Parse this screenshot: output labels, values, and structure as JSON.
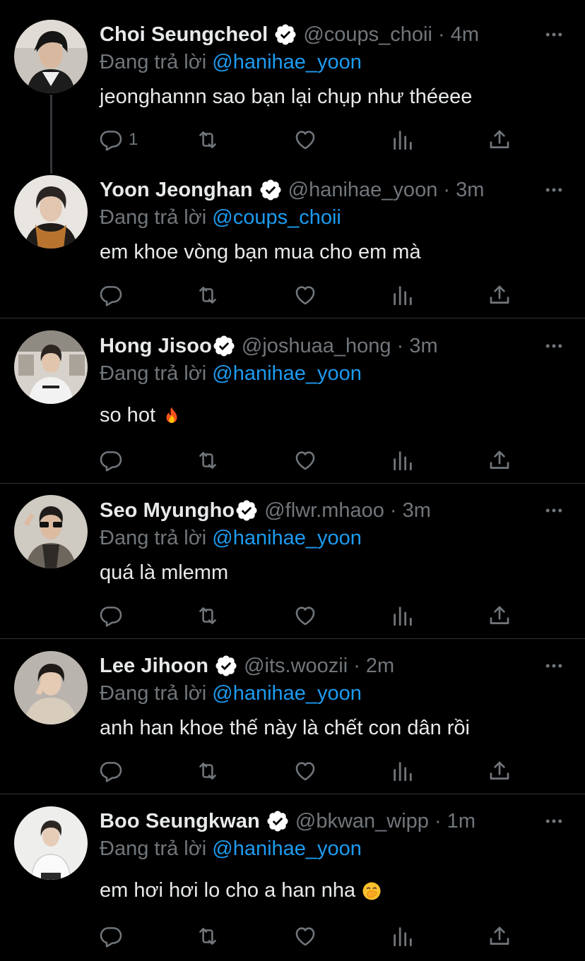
{
  "colors": {
    "background": "#000000",
    "text": "#e7e9ea",
    "muted": "#71767b",
    "link": "#1d9bf0",
    "verified": "#ffffff"
  },
  "tweets": [
    {
      "name": "Choi Seungcheol",
      "handle": "@coups_choii · 4m",
      "reply_prefix": "Đang trả lời ",
      "reply_mention": "@hanihae_yoon",
      "text": "jeonghannn sao bạn lại chụp như théeee",
      "emoji": "",
      "reply_count": "1",
      "avatar_icon": "avatar-dark-hair-icon"
    },
    {
      "name": "Yoon Jeonghan",
      "handle": "@hanihae_yoon · 3m",
      "reply_prefix": "Đang trả lời ",
      "reply_mention": "@coups_choii",
      "text": "em khoe vòng bạn mua cho em mà",
      "emoji": "",
      "reply_count": "",
      "avatar_icon": "avatar-brown-scarf-icon"
    },
    {
      "name": "Hong Jisoo",
      "handle": "@joshuaa_hong · 3m",
      "reply_prefix": "Đang trả lời ",
      "reply_mention": "@hanihae_yoon",
      "text": "so hot",
      "emoji": "fire-emoji",
      "reply_count": "",
      "avatar_icon": "avatar-white-tee-icon"
    },
    {
      "name": "Seo Myungho",
      "handle": "@flwr.mhaoo · 3m",
      "reply_prefix": "Đang trả lời ",
      "reply_mention": "@hanihae_yoon",
      "text": "quá là mlemm",
      "emoji": "",
      "reply_count": "",
      "avatar_icon": "avatar-sunglasses-icon"
    },
    {
      "name": "Lee Jihoon",
      "handle": "@its.woozii · 2m",
      "reply_prefix": "Đang trả lời ",
      "reply_mention": "@hanihae_yoon",
      "text": "anh han khoe thế này là chết con dân rồi",
      "emoji": "",
      "reply_count": "",
      "avatar_icon": "avatar-beige-sweater-icon"
    },
    {
      "name": "Boo Seungkwan",
      "handle": "@bkwan_wipp · 1m",
      "reply_prefix": "Đang trả lời ",
      "reply_mention": "@hanihae_yoon",
      "text": "em hơi hơi lo cho a han nha",
      "emoji": "hand-over-mouth-emoji",
      "reply_count": "",
      "avatar_icon": "avatar-white-shirt-icon"
    }
  ]
}
